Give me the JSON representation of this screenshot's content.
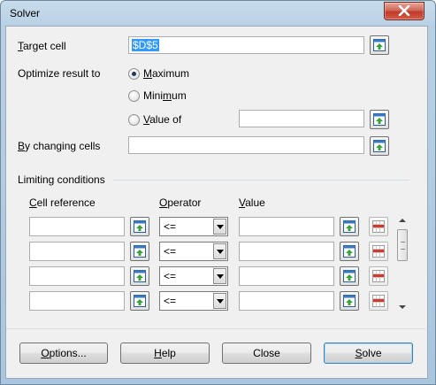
{
  "window": {
    "title": "Solver"
  },
  "target": {
    "label_pre": "",
    "label_key": "T",
    "label_post": "arget cell",
    "value": "$D$5"
  },
  "optimize": {
    "label": "Optimize result to",
    "maximum": {
      "key": "M",
      "rest": "aximum"
    },
    "minimum": {
      "pre": "Mini",
      "key": "m",
      "post": "um"
    },
    "value_of": {
      "key": "V",
      "rest": "alue of",
      "value": ""
    }
  },
  "changing": {
    "key": "B",
    "rest": "y changing cells",
    "value": ""
  },
  "limiting": {
    "label": "Limiting conditions",
    "headers": {
      "cell_reference": {
        "key": "C",
        "rest": "ell reference"
      },
      "operator": {
        "key": "O",
        "rest": "perator"
      },
      "value": {
        "key": "V",
        "rest": "alue"
      }
    },
    "rows": [
      {
        "cell": "",
        "operator": "<=",
        "value": ""
      },
      {
        "cell": "",
        "operator": "<=",
        "value": ""
      },
      {
        "cell": "",
        "operator": "<=",
        "value": ""
      },
      {
        "cell": "",
        "operator": "<=",
        "value": ""
      }
    ]
  },
  "buttons": {
    "options": {
      "key": "O",
      "rest": "ptions..."
    },
    "help": {
      "key": "H",
      "rest": "elp"
    },
    "close": {
      "label": "Close"
    },
    "solve": {
      "key": "S",
      "rest": "olve"
    }
  },
  "icons": {
    "shrink": "shrink-ref-icon",
    "delete": "delete-condition-icon",
    "close": "close-icon"
  },
  "colors": {
    "selection": "#3399ff",
    "close_button": "#c0392b",
    "frame": "#b8d0e4"
  }
}
